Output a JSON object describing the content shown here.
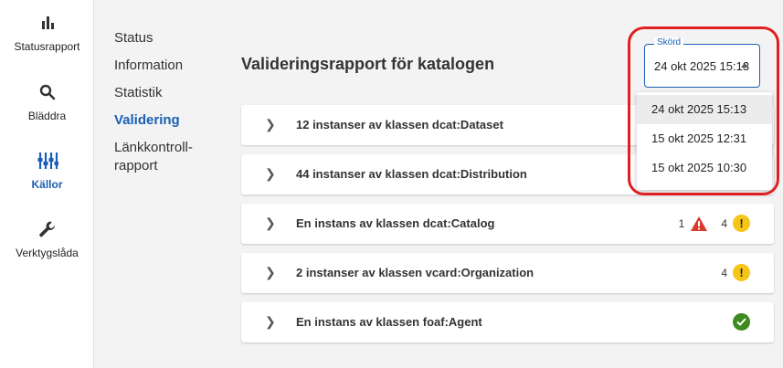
{
  "rail": {
    "items": [
      {
        "label": "Statusrapport",
        "icon": "bar-chart-icon"
      },
      {
        "label": "Bläddra",
        "icon": "search-icon"
      },
      {
        "label": "Källor",
        "icon": "sliders-icon"
      },
      {
        "label": "Verktygslåda",
        "icon": "wrench-icon"
      }
    ]
  },
  "subnav": {
    "items": [
      "Status",
      "Information",
      "Statistik",
      "Validering",
      "Länkkontroll-",
      "rapport"
    ]
  },
  "main": {
    "title": "Valideringsrapport för katalogen",
    "rows": [
      {
        "label": "12 instanser av klassen dcat:Dataset"
      },
      {
        "label": "44 instanser av klassen dcat:Distribution"
      },
      {
        "label": "En instans av klassen dcat:Catalog",
        "error_count": "1",
        "warning_count": "4"
      },
      {
        "label": "2 instanser av klassen vcard:Organization",
        "warning_count": "4"
      },
      {
        "label": "En instans av klassen foaf:Agent"
      }
    ]
  },
  "harvest_select": {
    "legend": "Skörd",
    "value": "24 okt 2025 15:13",
    "options": [
      "24 okt 2025 15:13",
      "15 okt 2025 12:31",
      "15 okt 2025 10:30"
    ]
  },
  "colors": {
    "accent": "#1a5fb4",
    "error": "#d93a2b",
    "warning": "#f5c518",
    "ok": "#3d8a1f",
    "highlight": "#e02020"
  }
}
